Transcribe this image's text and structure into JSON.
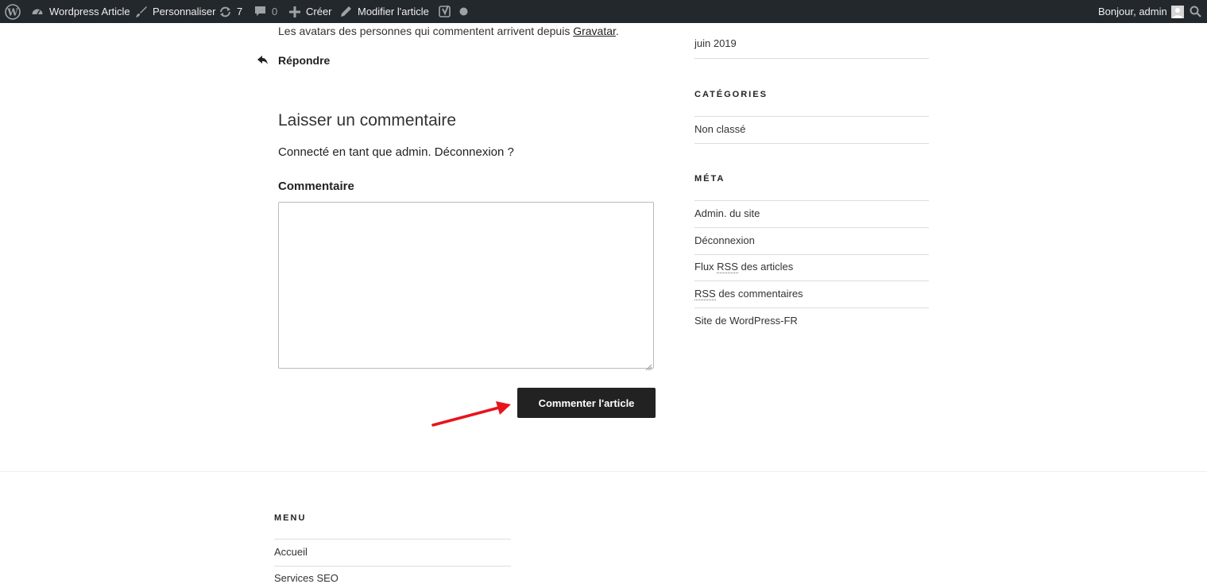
{
  "adminbar": {
    "site_name": "Wordpress Article",
    "customize": "Personnaliser",
    "updates_count": "7",
    "comments_count": "0",
    "new": "Créer",
    "edit_post": "Modifier l'article",
    "greeting": "Bonjour, admin"
  },
  "comments": {
    "avatars_note_prefix": "Les avatars des personnes qui commentent arrivent depuis ",
    "gravatar_link": "Gravatar",
    "avatars_note_suffix": ".",
    "reply_label": "Répondre"
  },
  "comment_form": {
    "title": "Laisser un commentaire",
    "logged_in_text": "Connecté en tant que admin. Déconnexion ?",
    "comment_label": "Commentaire",
    "submit_label": "Commenter l'article"
  },
  "sidebar": {
    "archives_item": "juin 2019",
    "categories_title": "CATÉGORIES",
    "categories": [
      "Non classé"
    ],
    "meta_title": "MÉTA",
    "meta_items": {
      "admin": "Admin. du site",
      "logout": "Déconnexion",
      "rss_entries_abbr": "RSS",
      "rss_entries_prefix": "Flux ",
      "rss_entries_suffix": " des articles",
      "rss_comments_abbr": "RSS",
      "rss_comments_suffix": " des commentaires",
      "wordpress": "Site de WordPress-FR"
    }
  },
  "footer": {
    "menu_title": "MENU",
    "items": [
      "Accueil",
      "Services SEO"
    ]
  },
  "colors": {
    "adminbar_bg": "#23282d",
    "button_bg": "#222222",
    "annotation_arrow": "#e8141c"
  },
  "icons": [
    "wordpress-logo-icon",
    "dashboard-icon",
    "brush-icon",
    "updates-icon",
    "comment-bubble-icon",
    "plus-icon",
    "pencil-icon",
    "yoast-icon",
    "status-dot-icon",
    "avatar-icon",
    "search-icon",
    "reply-arrow-icon",
    "resize-grip-icon",
    "annotation-arrow"
  ]
}
